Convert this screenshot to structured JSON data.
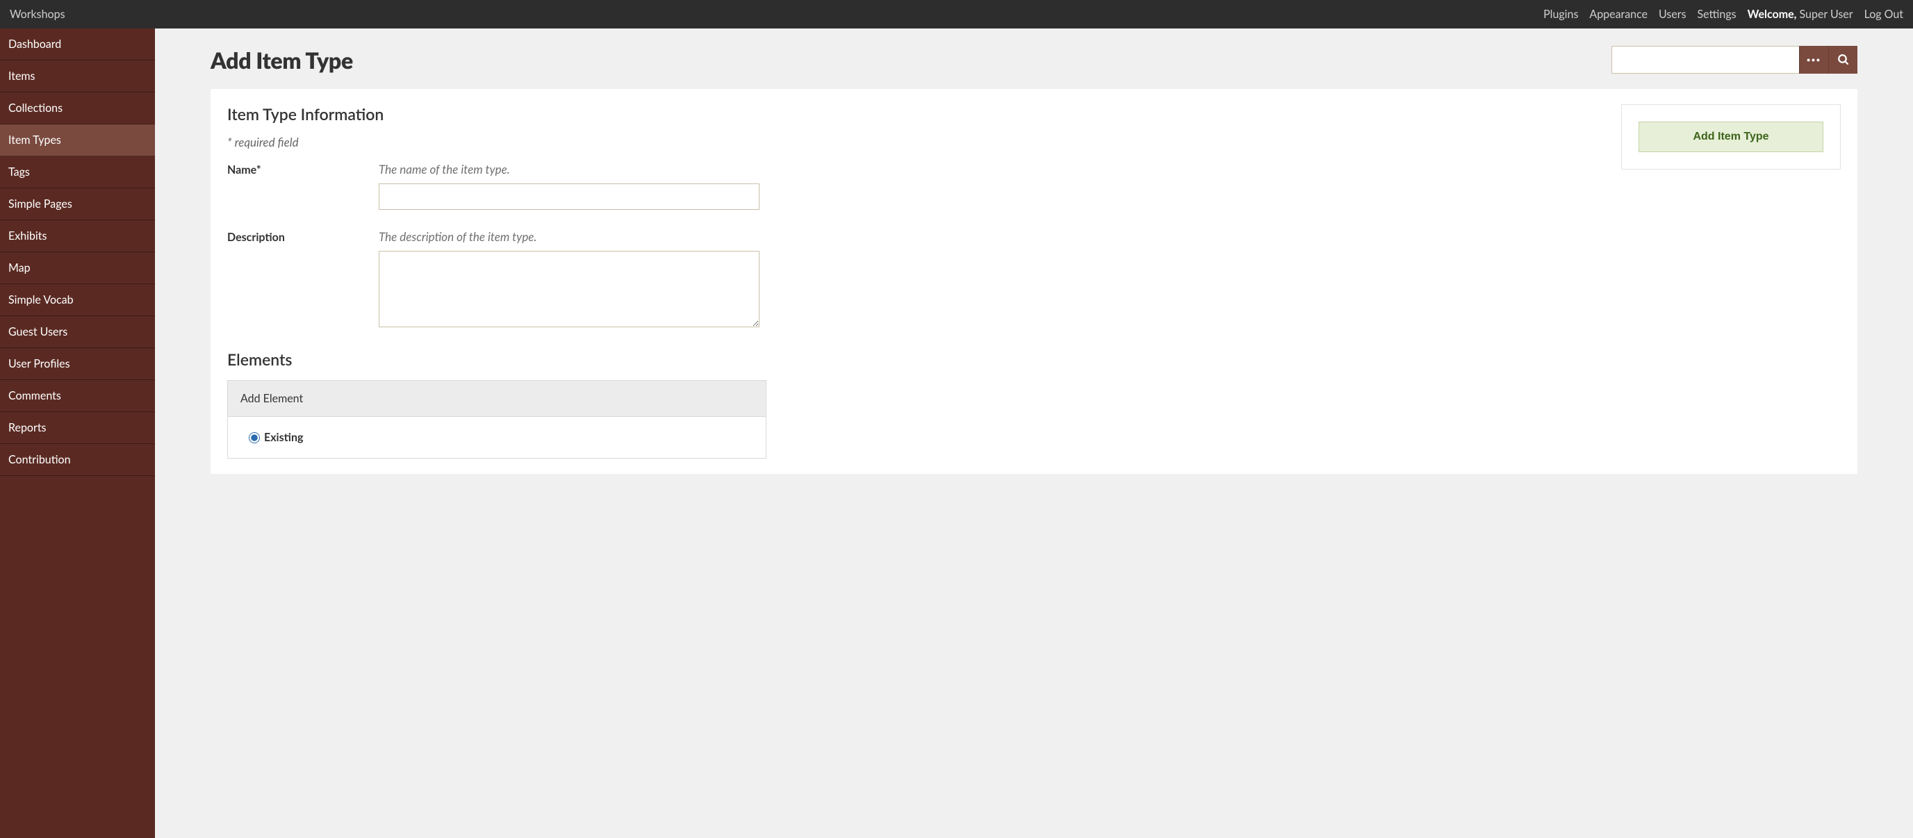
{
  "topbar": {
    "site_title": "Workshops",
    "links": {
      "plugins": "Plugins",
      "appearance": "Appearance",
      "users": "Users",
      "settings": "Settings"
    },
    "welcome_label": "Welcome,",
    "welcome_user": "Super User",
    "logout": "Log Out"
  },
  "sidebar": {
    "items": [
      {
        "label": "Dashboard"
      },
      {
        "label": "Items"
      },
      {
        "label": "Collections"
      },
      {
        "label": "Item Types"
      },
      {
        "label": "Tags"
      },
      {
        "label": "Simple Pages"
      },
      {
        "label": "Exhibits"
      },
      {
        "label": "Map"
      },
      {
        "label": "Simple Vocab"
      },
      {
        "label": "Guest Users"
      },
      {
        "label": "User Profiles"
      },
      {
        "label": "Comments"
      },
      {
        "label": "Reports"
      },
      {
        "label": "Contribution"
      }
    ],
    "active_index": 3
  },
  "page": {
    "title": "Add Item Type"
  },
  "search": {
    "value": "",
    "placeholder": ""
  },
  "form": {
    "section_title": "Item Type Information",
    "required_note": "* required field",
    "name": {
      "label": "Name*",
      "hint": "The name of the item type.",
      "value": ""
    },
    "description": {
      "label": "Description",
      "hint": "The description of the item type.",
      "value": ""
    },
    "elements": {
      "heading": "Elements",
      "add_label": "Add Element",
      "existing_label": "Existing",
      "existing_checked": true
    }
  },
  "aside": {
    "submit_label": "Add Item Type"
  }
}
